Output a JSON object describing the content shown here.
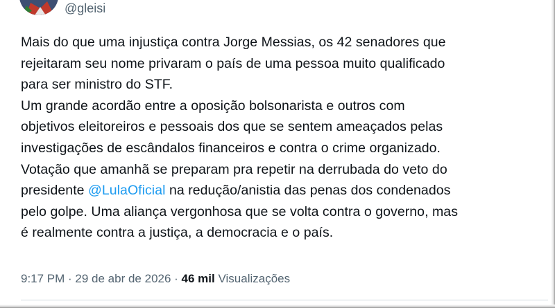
{
  "author": {
    "handle": "@gleisi",
    "avatar_icon": "profile-photo"
  },
  "tweet": {
    "lines": [
      {
        "text": "Mais do que uma injustiça contra Jorge Messias, os 42 senadores que"
      },
      {
        "text": "rejeitaram seu nome privaram o país de uma pessoa muito qualificado"
      },
      {
        "text": "para ser ministro do STF."
      },
      {
        "text": "Um grande acordão entre a oposição bolsonarista e outros com"
      },
      {
        "text": "objetivos eleitoreiros e pessoais dos que se sentem ameaçados pelas"
      },
      {
        "text": "investigações de escândalos financeiros e contra o crime organizado."
      },
      {
        "text": "Votação que amanhã se preparam pra repetir na derrubada do veto do"
      },
      {
        "before": "presidente ",
        "mention": "@LulaOficial",
        "after": " na redução/anistia das penas dos condenados"
      },
      {
        "text": "pelo golpe. Uma aliança vergonhosa que se volta contra o governo, mas"
      },
      {
        "text": "é realmente contra a justiça, a democracia e o país."
      }
    ]
  },
  "meta": {
    "time": "9:17 PM",
    "separator": " · ",
    "date": "29 de abr de 2026",
    "views_count": "46 mil",
    "views_label": "Visualizações"
  },
  "colors": {
    "text": "#0f1419",
    "secondary": "#536471",
    "link": "#1d9bf0"
  }
}
